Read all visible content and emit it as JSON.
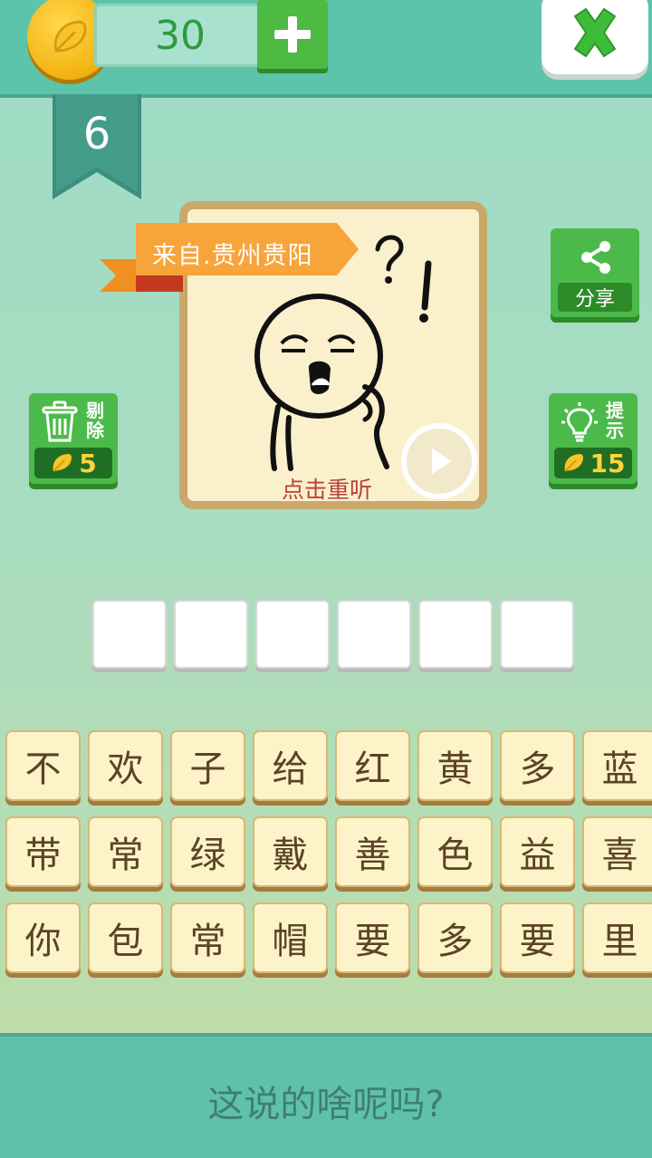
{
  "header": {
    "coins": "30",
    "coin_icon": "leaf-coin-icon",
    "add_icon": "plus-icon",
    "close_icon": "close-x-icon"
  },
  "level": {
    "number": "6"
  },
  "puzzle": {
    "origin": "来自.贵州贵阳",
    "replay_label": "点击重听",
    "play_icon": "play-icon"
  },
  "side_buttons": {
    "share": {
      "label": "分享",
      "icon": "share-icon"
    },
    "delete": {
      "label_line1": "剔",
      "label_line2": "除",
      "cost": "5",
      "icon": "trash-icon"
    },
    "hint": {
      "label_line1": "提",
      "label_line2": "示",
      "cost": "15",
      "icon": "lightbulb-icon"
    }
  },
  "answer_slots": [
    "",
    "",
    "",
    "",
    "",
    ""
  ],
  "letters": [
    "不",
    "欢",
    "子",
    "给",
    "红",
    "黄",
    "多",
    "蓝",
    "带",
    "常",
    "绿",
    "戴",
    "善",
    "色",
    "益",
    "喜",
    "你",
    "包",
    "常",
    "帽",
    "要",
    "多",
    "要",
    "里"
  ],
  "footer": {
    "caption": "这说的啥呢吗?"
  },
  "colors": {
    "top_bar": "#5cc4ab",
    "green_button": "#4cba4a",
    "tile_bg": "#fdf3c8",
    "tile_border": "#d6b877",
    "origin_tag": "#f7a43a",
    "replay_text": "#b5443a"
  }
}
